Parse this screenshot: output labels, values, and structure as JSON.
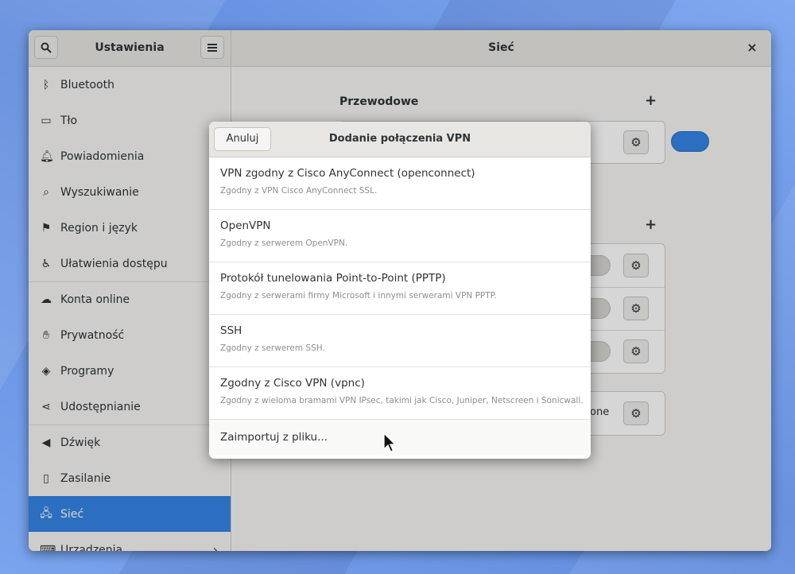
{
  "window": {
    "sidebar_title": "Ustawienia",
    "content_title": "Sieć",
    "close_label": "×"
  },
  "sidebar": {
    "items": [
      {
        "label": "Bluetooth",
        "icon": "bluetooth-icon"
      },
      {
        "label": "Tło",
        "icon": "display-icon"
      },
      {
        "label": "Powiadomienia",
        "icon": "bell-icon"
      },
      {
        "label": "Wyszukiwanie",
        "icon": "search-icon"
      },
      {
        "label": "Region i język",
        "icon": "flag-icon"
      },
      {
        "label": "Ułatwienia dostępu",
        "icon": "accessibility-icon"
      },
      {
        "label": "Konta online",
        "icon": "cloud-icon"
      },
      {
        "label": "Prywatność",
        "icon": "hand-icon"
      },
      {
        "label": "Programy",
        "icon": "apps-icon"
      },
      {
        "label": "Udostępnianie",
        "icon": "share-icon"
      },
      {
        "label": "Dźwięk",
        "icon": "speaker-icon"
      },
      {
        "label": "Zasilanie",
        "icon": "battery-icon"
      },
      {
        "label": "Sieć",
        "icon": "network-icon",
        "active": true
      },
      {
        "label": "Urządzenia",
        "icon": "devices-icon"
      }
    ]
  },
  "network": {
    "wired_title": "Przewodowe",
    "proxy_partial": "one"
  },
  "dialog": {
    "cancel_label": "Anuluj",
    "title": "Dodanie połączenia VPN",
    "options": [
      {
        "name": "VPN zgodny z Cisco AnyConnect (openconnect)",
        "desc": "Zgodny z VPN Cisco AnyConnect SSL."
      },
      {
        "name": "OpenVPN",
        "desc": "Zgodny z serwerem OpenVPN."
      },
      {
        "name": "Protokół tunelowania Point-to-Point (PPTP)",
        "desc": "Zgodny z serwerami firmy Microsoft i innymi serwerami VPN PPTP."
      },
      {
        "name": "SSH",
        "desc": "Zgodny z serwerem SSH."
      },
      {
        "name": "Zgodny z Cisco VPN (vpnc)",
        "desc": "Zgodny z wieloma bramami VPN IPsec, takimi jak Cisco, Juniper, Netscreen i Sonicwall."
      }
    ],
    "import_label": "Zaimportuj z pliku..."
  },
  "colors": {
    "accent": "#3584e4"
  }
}
